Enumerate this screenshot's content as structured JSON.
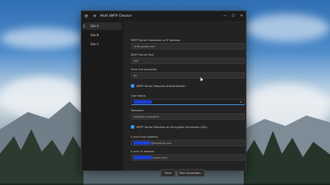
{
  "window": {
    "title": "Multi SMTP Checker",
    "menu_icon": "hamburger-icon",
    "app_icon": "plus-icon",
    "min": "—",
    "max": "☐",
    "close": "✕"
  },
  "sidebar": {
    "items": [
      {
        "label": "Site A",
        "selected": true
      },
      {
        "label": "Site B",
        "selected": false
      },
      {
        "label": "Site C",
        "selected": false
      }
    ]
  },
  "form": {
    "host_label": "SMTP Server Hostname or IP Address",
    "host_value": "smtp.gmail.com",
    "port_label": "SMTP Server Port",
    "port_value": "587",
    "timeout_label": "Time Out (seconds)",
    "timeout_value": "60",
    "auth_label": "SMTP Server Requires Authentication",
    "auth_checked": true,
    "user_label": "User Name",
    "user_value_suffix": "",
    "user_clear": "✕",
    "password_label": "Password",
    "password_value": "example_password",
    "ssl_label": "SMTP Server Requires an Encrypted Connection (SSL)",
    "ssl_checked": true,
    "from_label": "E-mail From Address",
    "from_value_suffix": "@example.com",
    "to_label": "E-mail To Address",
    "to_value_suffix": "ample.com"
  },
  "buttons": {
    "save": "Save",
    "test": "Test Connection..."
  },
  "colors": {
    "accent": "#2e8cf0",
    "redaction": "#1b3fd6"
  }
}
